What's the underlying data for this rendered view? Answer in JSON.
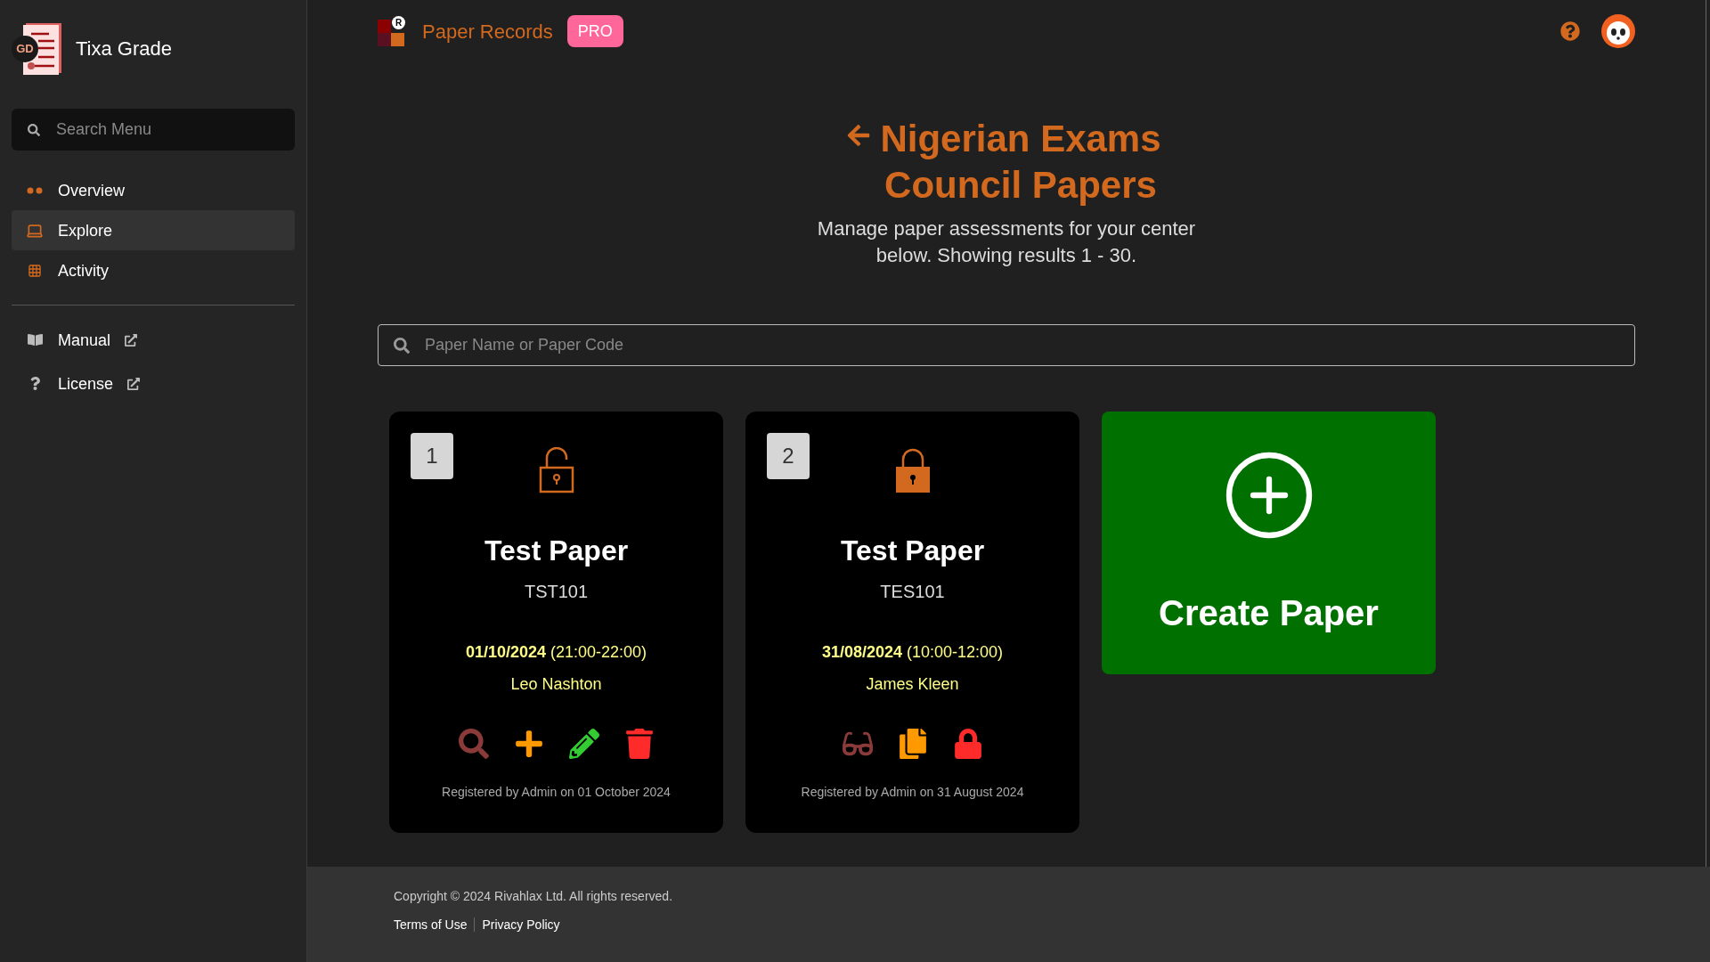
{
  "sidebar": {
    "logo_badge": "GD",
    "app_name": "Tixa Grade",
    "search": {
      "placeholder": "Search Menu"
    },
    "items": [
      {
        "label": "Overview",
        "selected": false
      },
      {
        "label": "Explore",
        "selected": true
      },
      {
        "label": "Activity",
        "selected": false
      }
    ],
    "links": [
      {
        "label": "Manual"
      },
      {
        "label": "License"
      }
    ]
  },
  "header": {
    "logo_mark": "R",
    "title": "Paper Records",
    "badge": "PRO"
  },
  "page": {
    "title": "Nigerian Exams Council Papers",
    "subtitle": "Manage paper assessments for your center below. Showing results 1 - 30.",
    "search": {
      "placeholder": "Paper Name or Paper Code"
    }
  },
  "papers": [
    {
      "number": "1",
      "locked": false,
      "name": "Test Paper",
      "code": "TST101",
      "schedule": "**01/10/2024** (21:00-22:00)",
      "examiner": "Leo Nashton",
      "actions": [
        {
          "kind": "view"
        },
        {
          "kind": "add"
        },
        {
          "kind": "edit"
        },
        {
          "kind": "delete"
        }
      ],
      "registered": "Registered by Admin on 01 October 2024"
    },
    {
      "number": "2",
      "locked": true,
      "name": "Test Paper",
      "code": "TES101",
      "schedule": "**31/08/2024** (10:00-12:00)",
      "examiner": "James Kleen",
      "actions": [
        {
          "kind": "preview"
        },
        {
          "kind": "copy"
        },
        {
          "kind": "lock"
        }
      ],
      "registered": "Registered by Admin on 31 August 2024"
    }
  ],
  "create_card": {
    "label": "Create Paper"
  },
  "footer": {
    "copyright": "Copyright © 2024 Rivahlax Ltd. All rights reserved.",
    "links": [
      "Terms of Use",
      "Privacy Policy"
    ]
  }
}
